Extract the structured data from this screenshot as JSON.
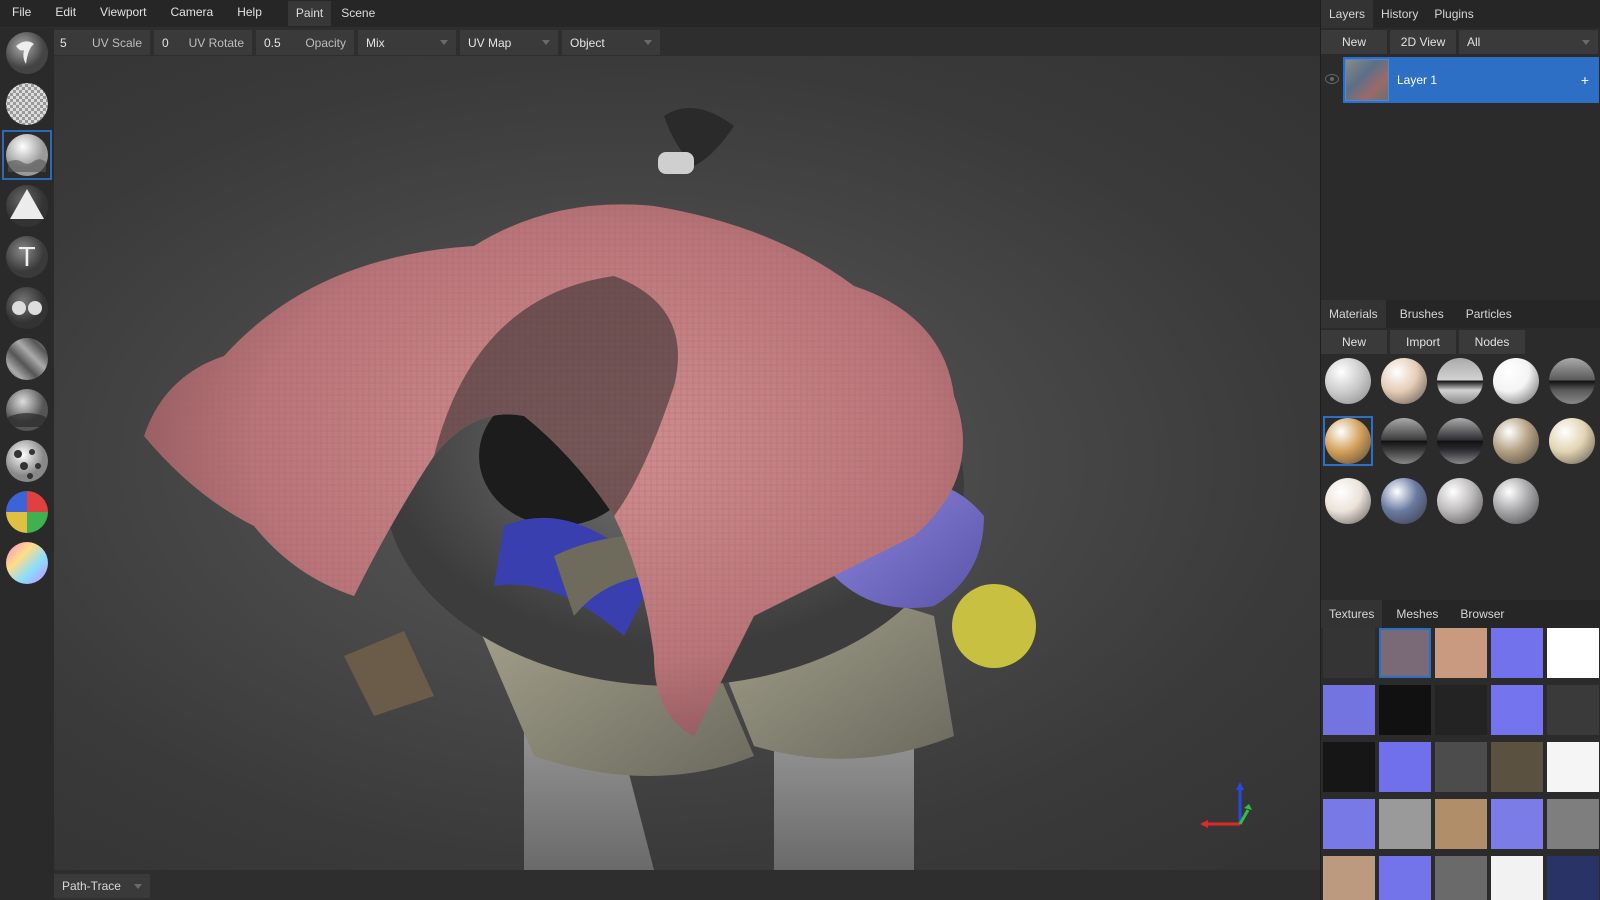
{
  "menu": [
    "File",
    "Edit",
    "Viewport",
    "Camera",
    "Help"
  ],
  "workspace_tabs": [
    "Paint",
    "Scene"
  ],
  "toolbar": {
    "uv_scale_value": "5",
    "uv_scale_label": "UV Scale",
    "uv_rotate_value": "0",
    "uv_rotate_label": "UV Rotate",
    "opacity_value": "0.5",
    "opacity_label": "Opacity",
    "blend_mode": "Mix",
    "texcoord": "UV Map",
    "space": "Object"
  },
  "tools": [
    {
      "name": "brush-tool-icon"
    },
    {
      "name": "eraser-tool-icon"
    },
    {
      "name": "fill-tool-icon"
    },
    {
      "name": "decal-tool-icon"
    },
    {
      "name": "text-tool-icon"
    },
    {
      "name": "clone-tool-icon"
    },
    {
      "name": "blur-tool-icon"
    },
    {
      "name": "smudge-tool-icon"
    },
    {
      "name": "particle-tool-icon"
    },
    {
      "name": "colorid-tool-icon"
    },
    {
      "name": "picker-tool-icon"
    }
  ],
  "status": {
    "render_mode": "Path-Trace"
  },
  "layers_panel": {
    "tabs": [
      "Layers",
      "History",
      "Plugins"
    ],
    "buttons": [
      "New",
      "2D View"
    ],
    "filter": "All",
    "layers": [
      {
        "name": "Layer 1"
      }
    ]
  },
  "materials_panel": {
    "tabs": [
      "Materials",
      "Brushes",
      "Particles"
    ],
    "buttons": [
      "New",
      "Import",
      "Nodes"
    ],
    "materials": [
      {
        "color": "#c8c8c8",
        "pattern": "marble"
      },
      {
        "color": "#e6cdb6"
      },
      {
        "color": "#d2d2d2",
        "pattern": "metal"
      },
      {
        "color": "#f4f4f4"
      },
      {
        "color": "#5a5a5a",
        "pattern": "metal"
      },
      {
        "color": "#d3a15c",
        "selected": true
      },
      {
        "color": "#3c3c3c",
        "pattern": "chrome"
      },
      {
        "color": "#2e2e33",
        "pattern": "chrome"
      },
      {
        "color": "#b5a184"
      },
      {
        "color": "#e3d5b3"
      },
      {
        "color": "#ece3da"
      },
      {
        "color": "#6a7aa0"
      },
      {
        "color": "#bdbabb"
      },
      {
        "color": "#a7a7aa"
      }
    ]
  },
  "textures_panel": {
    "tabs": [
      "Textures",
      "Meshes",
      "Browser"
    ],
    "textures": [
      "#343434",
      "#7a6a78",
      "#c99a80",
      "#7272ec",
      "#ffffff",
      "#7474e0",
      "#111111",
      "#232323",
      "#7474ee",
      "#3a3a3a",
      "#161616",
      "#7070ec",
      "#4c4c4c",
      "#5a5140",
      "#f5f5f5",
      "#7878e6",
      "#9a9a9a",
      "#b08e6a",
      "#7c7ce8",
      "#7e7e7e",
      "#bc9a80",
      "#7474ea",
      "#6a6a6a",
      "#f2f2f2",
      "#2a3366"
    ],
    "selected_index": 1
  }
}
